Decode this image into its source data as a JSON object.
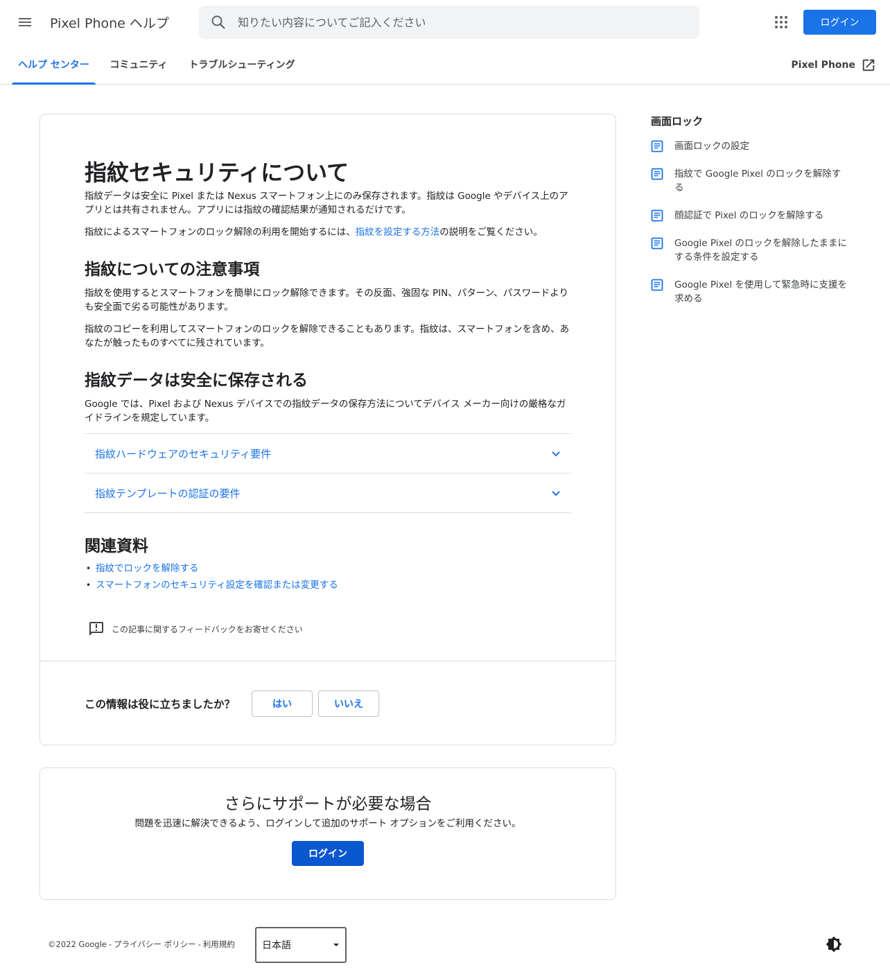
{
  "header": {
    "product_title": "Pixel Phone ヘルプ",
    "search_placeholder": "知りたい内容についてご記入ください",
    "login_label": "ログイン"
  },
  "tabs": [
    {
      "label": "ヘルプ センター",
      "active": true
    },
    {
      "label": "コミュニティ",
      "active": false
    },
    {
      "label": "トラブルシューティング",
      "active": false
    }
  ],
  "external_link": {
    "label": "Pixel Phone"
  },
  "article": {
    "title": "指紋セキュリティについて",
    "intro_p1": "指紋データは安全に Pixel または Nexus スマートフォン上にのみ保存されます。指紋は Google やデバイス上のアプリとは共有されません。アプリには指紋の確認結果が通知されるだけです。",
    "intro_p2_before": "指紋によるスマートフォンのロック解除の利用を開始するには、",
    "intro_p2_link": "指紋を設定する方法",
    "intro_p2_after": "の説明をご覧ください。",
    "section1_title": "指紋についての注意事項",
    "section1_p1": "指紋を使用するとスマートフォンを簡単にロック解除できます。その反面、強固な PIN、パターン、パスワードよりも安全面で劣る可能性があります。",
    "section1_p2": "指紋のコピーを利用してスマートフォンのロックを解除できることもあります。指紋は、スマートフォンを含め、あなたが触ったものすべてに残されています。",
    "section2_title": "指紋データは安全に保存される",
    "section2_p1": "Google では、Pixel および Nexus デバイスでの指紋データの保存方法についてデバイス メーカー向けの厳格なガイドラインを規定しています。",
    "expanders": [
      {
        "label": "指紋ハードウェアのセキュリティ要件"
      },
      {
        "label": "指紋テンプレートの認証の要件"
      }
    ],
    "related_title": "関連資料",
    "related_links": [
      {
        "label": "指紋でロックを解除する"
      },
      {
        "label": "スマートフォンのセキュリティ設定を確認または変更する"
      }
    ],
    "feedback_label": "この記事に関するフィードバックをお寄せください",
    "helpful_question": "この情報は役に立ちましたか？",
    "yes_label": "はい",
    "no_label": "いいえ"
  },
  "support": {
    "title": "さらにサポートが必要な場合",
    "text": "問題を迅速に解決できるよう、ログインして追加のサポート オプションをご利用ください。",
    "login_label": "ログイン"
  },
  "sidebar": {
    "title": "画面ロック",
    "items": [
      {
        "label": "画面ロックの設定"
      },
      {
        "label": "指紋で Google Pixel のロックを解除する"
      },
      {
        "label": "顔認証で Pixel のロックを解除する"
      },
      {
        "label": "Google Pixel のロックを解除したままにする条件を設定する"
      },
      {
        "label": "Google Pixel を使用して緊急時に支援を求める"
      }
    ]
  },
  "footer": {
    "copyright": "©2022 Google",
    "privacy": "プライバシー ポリシー",
    "terms": "利用規約",
    "language": "日本語"
  },
  "colors": {
    "accent": "#1a73e8",
    "login_dark": "#0b57d0",
    "border": "#dadce0"
  }
}
